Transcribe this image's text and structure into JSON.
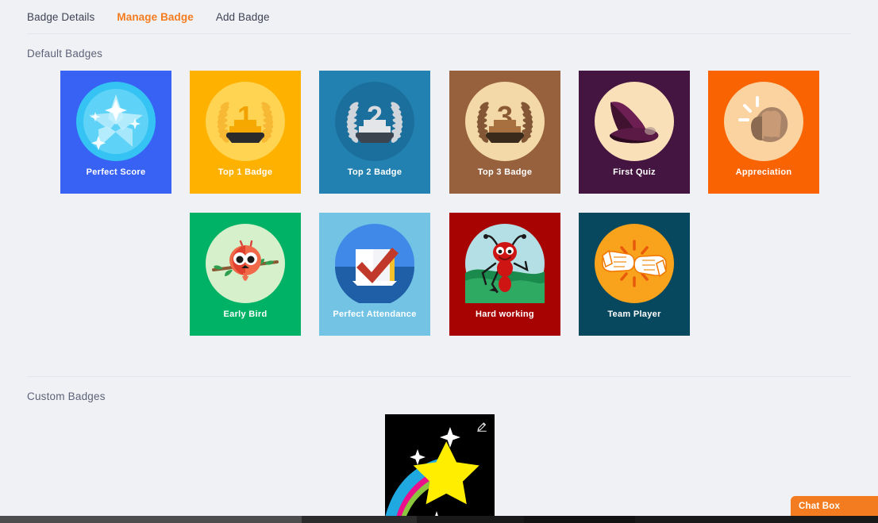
{
  "tabs": [
    {
      "label": "Badge Details",
      "active": false
    },
    {
      "label": "Manage Badge",
      "active": true
    },
    {
      "label": "Add Badge",
      "active": false
    }
  ],
  "sections": {
    "default_title": "Default Badges",
    "custom_title": "Custom Badges"
  },
  "accent_color": "#f47c20",
  "page_background": "#f0f1f5",
  "default_badges": [
    {
      "label": "Perfect Score",
      "tile": "#3762f4",
      "art": "perfect-score-star-icon",
      "circle": "#35c3f3",
      "row": 0,
      "col": 0
    },
    {
      "label": "Top 1 Badge",
      "tile": "#ffb100",
      "art": "top-1-laurel-podium-icon",
      "circle": "#ffd452",
      "row": 0,
      "col": 1
    },
    {
      "label": "Top 2 Badge",
      "tile": "#2281b0",
      "art": "top-2-laurel-podium-icon",
      "circle": "#1b6f9c",
      "row": 0,
      "col": 2
    },
    {
      "label": "Top 3 Badge",
      "tile": "#96613c",
      "art": "top-3-laurel-podium-icon",
      "circle": "#f4d9a8",
      "row": 0,
      "col": 3
    },
    {
      "label": "First Quiz",
      "tile": "#451541",
      "art": "wizard-hat-icon",
      "circle": "#fae0b8",
      "row": 0,
      "col": 4
    },
    {
      "label": "Appreciation",
      "tile": "#f96302",
      "art": "clapping-hands-icon",
      "circle": "#fbd3a0",
      "row": 0,
      "col": 5
    },
    {
      "label": "Early Bird",
      "tile": "#00b265",
      "art": "early-bird-icon",
      "circle": "#d7f0cc",
      "row": 1,
      "col": 1
    },
    {
      "label": "Perfect Attendance",
      "tile": "#72c3e4",
      "art": "checkmark-book-icon",
      "circle": "#4189e8",
      "row": 1,
      "col": 2
    },
    {
      "label": "Hard working",
      "tile": "#a80303",
      "art": "working-ant-icon",
      "circle": "#b4dfe4",
      "row": 1,
      "col": 3
    },
    {
      "label": "Team Player",
      "tile": "#07485e",
      "art": "fist-bump-icon",
      "circle": "#f9a21b",
      "row": 1,
      "col": 4
    }
  ],
  "custom_badges": [
    {
      "label": "",
      "tile": "#000000",
      "art": "shooting-star-icon",
      "edit_icon": "pencil-edit-icon"
    }
  ],
  "chat": {
    "label": "Chat Box"
  }
}
